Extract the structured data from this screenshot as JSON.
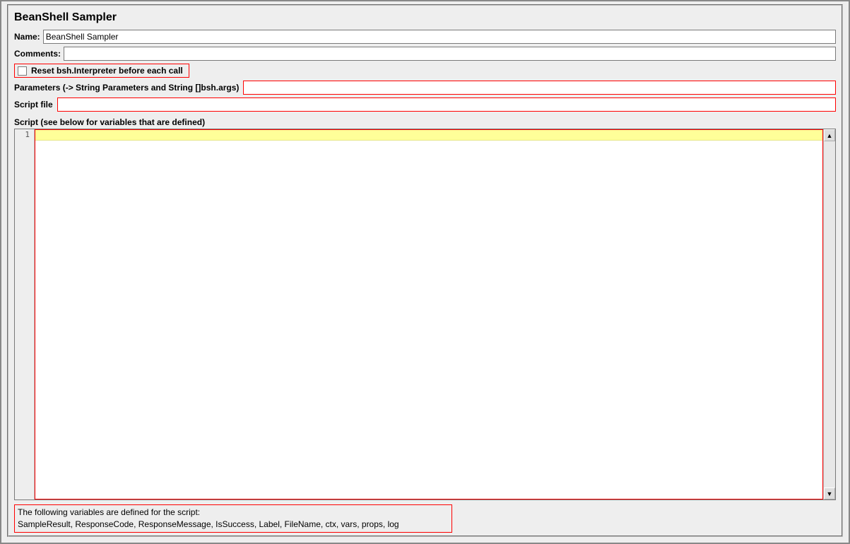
{
  "title": "BeanShell Sampler",
  "name": {
    "label": "Name:",
    "value": "BeanShell Sampler"
  },
  "comments": {
    "label": "Comments:",
    "value": ""
  },
  "resetInterpreter": {
    "label": "Reset bsh.Interpreter before each call",
    "checked": false
  },
  "parameters": {
    "label": "Parameters (-> String Parameters and String []bsh.args)",
    "value": ""
  },
  "scriptFile": {
    "label": "Script file",
    "value": ""
  },
  "scriptSection": {
    "label": "Script (see below for variables that are defined)",
    "gutterLine": "1",
    "content": ""
  },
  "footer": {
    "line1": "The following variables are defined for the script:",
    "line2": "SampleResult, ResponseCode, ResponseMessage, IsSuccess, Label, FileName, ctx, vars, props, log"
  }
}
